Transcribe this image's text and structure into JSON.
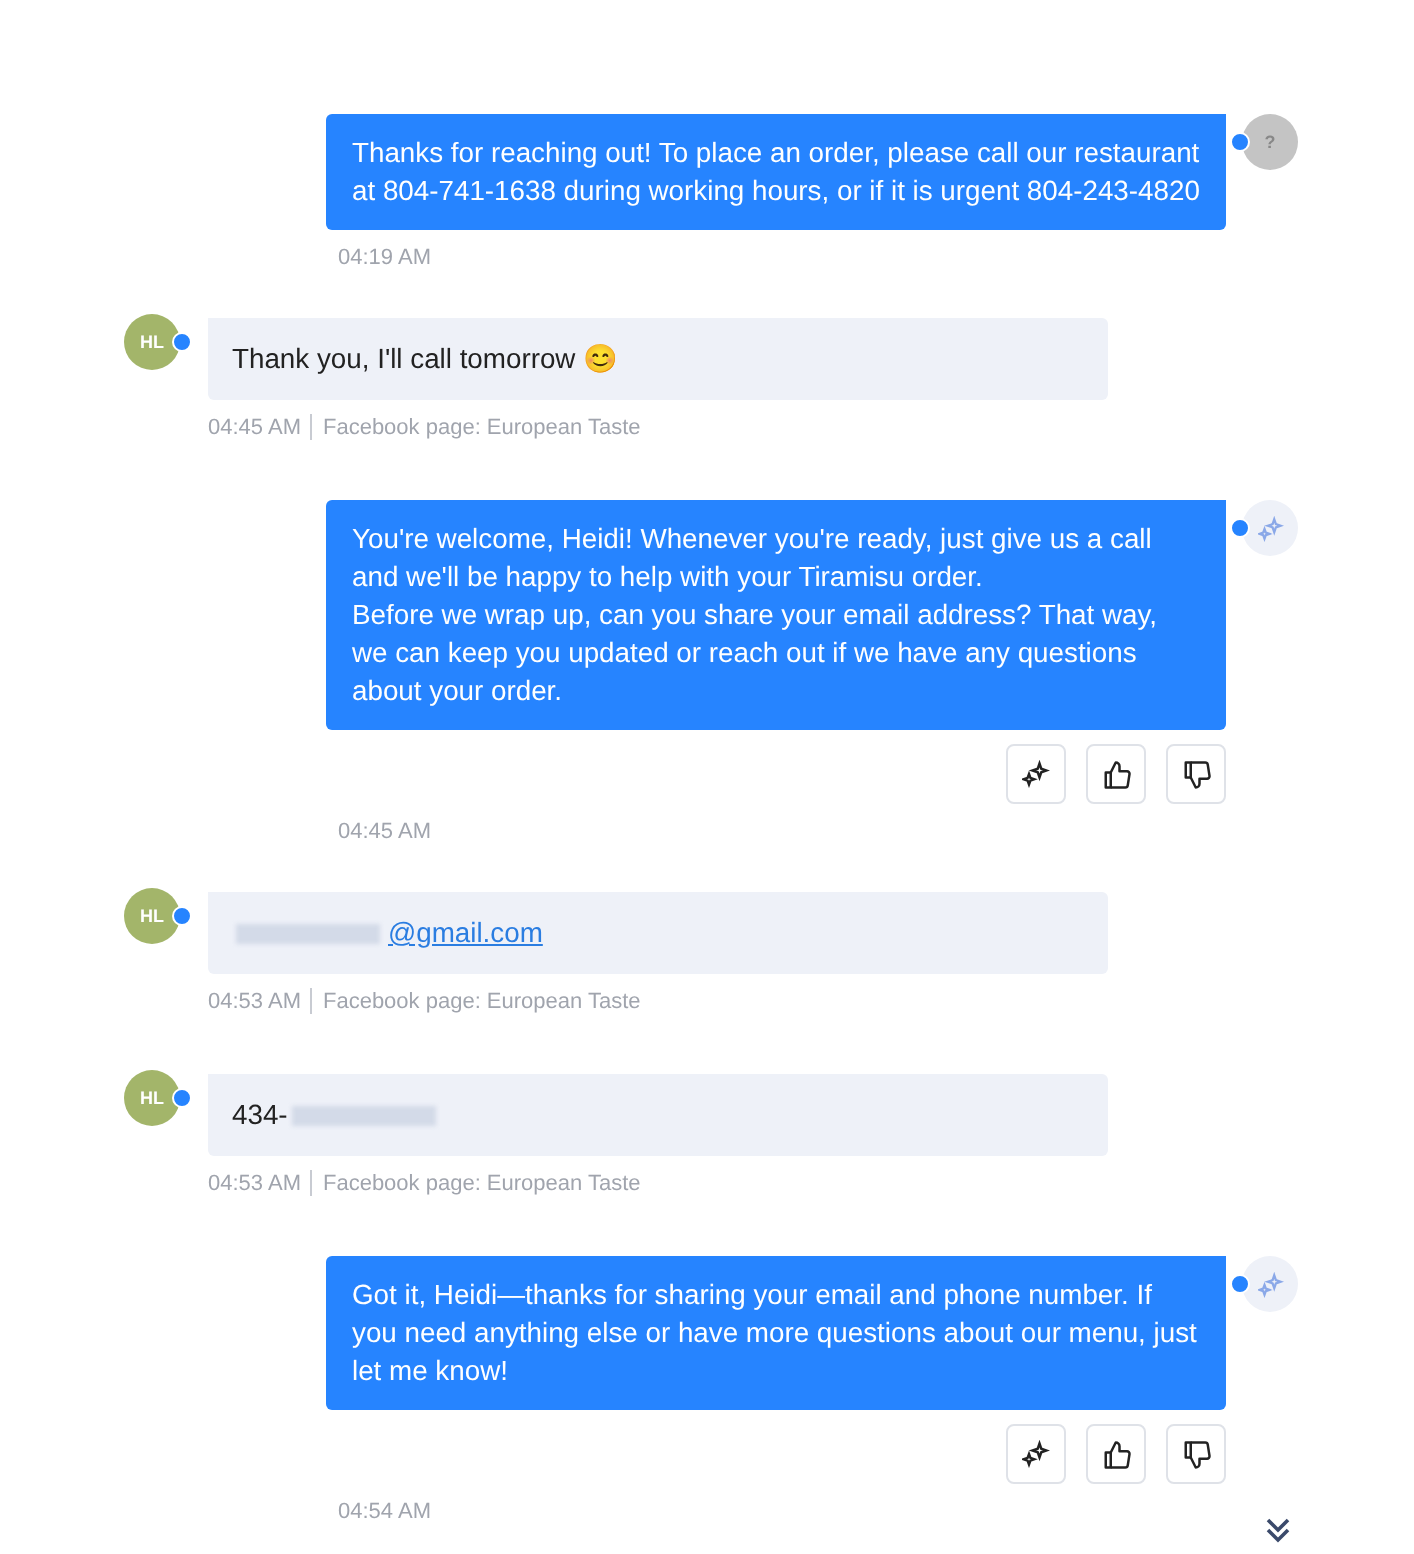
{
  "messages": [
    {
      "kind": "out",
      "avatar": {
        "kind": "unknown",
        "text": "?"
      },
      "text": "Thanks for reaching out! To place an order, please call our restaurant at 804-741-1638 during working hours, or if it is urgent 804-243-4820",
      "time": "04:19 AM",
      "feedback": false
    },
    {
      "kind": "in",
      "avatar": {
        "kind": "initials",
        "text": "HL"
      },
      "parts": [
        {
          "kind": "text",
          "text": "Thank you, I'll call tomorrow 😊"
        }
      ],
      "time": "04:45 AM",
      "source": "Facebook page: European Taste"
    },
    {
      "kind": "out",
      "avatar": {
        "kind": "ai"
      },
      "text": "You're welcome, Heidi! Whenever you're ready, just give us a call and we'll be happy to help with your Tiramisu order.\nBefore we wrap up, can you share your email address? That way, we can keep you updated or reach out if we have any questions about your order.",
      "time": "04:45 AM",
      "feedback": true
    },
    {
      "kind": "in",
      "avatar": {
        "kind": "initials",
        "text": "HL"
      },
      "parts": [
        {
          "kind": "redacted"
        },
        {
          "kind": "link",
          "text": "@gmail.com"
        }
      ],
      "time": "04:53 AM",
      "source": "Facebook page: European Taste"
    },
    {
      "kind": "in",
      "avatar": {
        "kind": "initials",
        "text": "HL"
      },
      "parts": [
        {
          "kind": "text",
          "text": "434-"
        },
        {
          "kind": "redacted"
        }
      ],
      "time": "04:53 AM",
      "source": "Facebook page: European Taste"
    },
    {
      "kind": "out",
      "avatar": {
        "kind": "ai"
      },
      "text": "Got it, Heidi—thanks for sharing your email and phone number. If you need anything else or have more questions about our menu, just let me know!",
      "time": "04:54 AM",
      "feedback": true
    }
  ]
}
